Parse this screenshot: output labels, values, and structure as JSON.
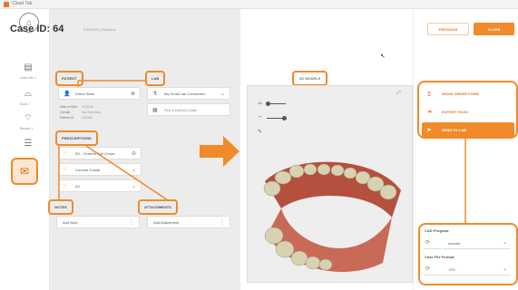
{
  "window": {
    "title": "Cloud Tab"
  },
  "nav": {
    "captions": [
      {
        "label": "Case Info",
        "check": "✓"
      },
      {
        "label": "Scan",
        "check": "✓"
      },
      {
        "label": "Review",
        "check": "✓"
      }
    ]
  },
  "case": {
    "title": "Case ID: 64",
    "subtitle": "3/15/2024 | Ravena"
  },
  "patient": {
    "section_label": "PATIENT",
    "name": "Direct Stars",
    "fields": [
      {
        "key": "Date of Birth",
        "value": "01/02/01"
      },
      {
        "key": "Gender",
        "value": "Not Specified"
      },
      {
        "key": "Patient ID",
        "value": "123456"
      }
    ]
  },
  "lab": {
    "section_label": "LAB",
    "name": "My Email Lab Connection",
    "delivery_placeholder": "Pick a Delivery Date"
  },
  "prescriptions": {
    "section_label": "PRESCRIPTIONS",
    "items": [
      "3D - Ceramic Full Crown",
      "Chrome Cobalt",
      "A2"
    ]
  },
  "notes": {
    "section_label": "NOTES",
    "add_label": "Add Note"
  },
  "attachments": {
    "section_label": "ATTACHMENTS",
    "add_label": "Add Attachment"
  },
  "viewer": {
    "models_label": "3D MODELS"
  },
  "actions": {
    "previous_label": "PREVIOUS",
    "close_label": "CLOSE",
    "items": [
      {
        "label": "SHOW ORDER FORM",
        "icon": "document-icon"
      },
      {
        "label": "EXPORT FILES",
        "icon": "export-icon"
      },
      {
        "label": "SEND TO LAB",
        "icon": "send-icon"
      }
    ]
  },
  "settings": {
    "cad_label": "CAD Program:",
    "cad_value": "exocad",
    "format_label": "Case File Format:",
    "format_value": ".STL"
  },
  "colors": {
    "accent": "#f08a2a",
    "accent_light": "#fde6d2",
    "panel": "#ececec"
  }
}
